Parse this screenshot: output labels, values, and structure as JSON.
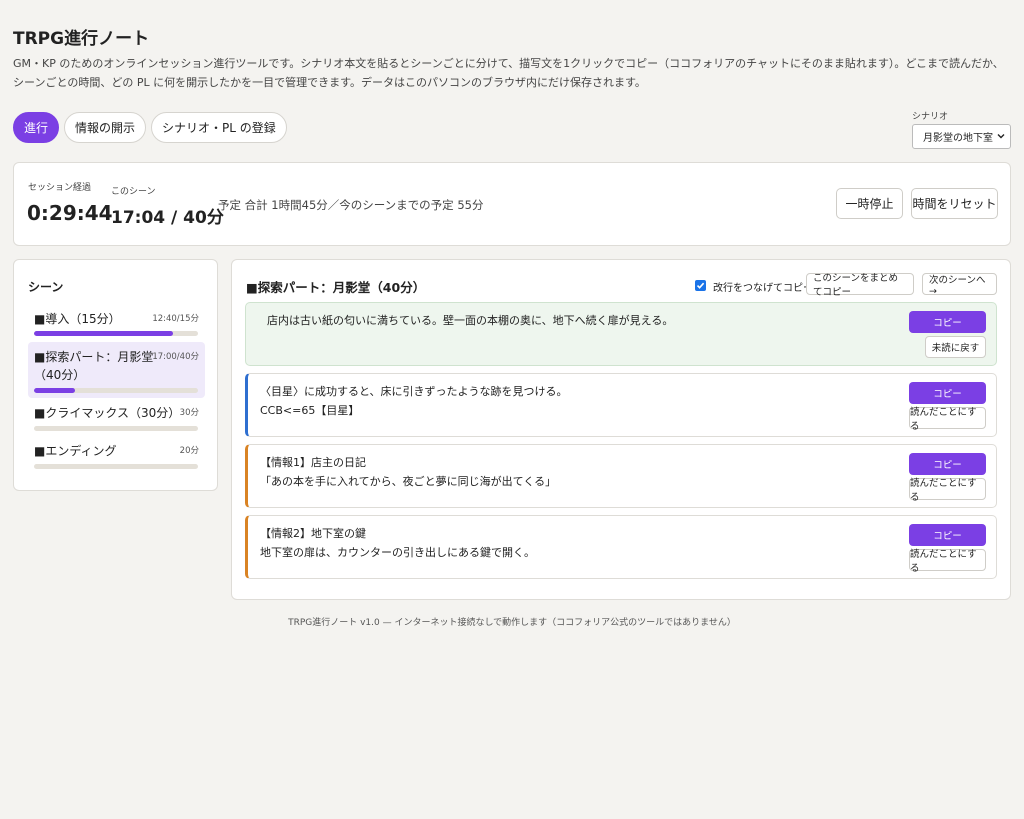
{
  "app": {
    "title": "TRPG進行ノート",
    "description": "GM・KP のためのオンラインセッション進行ツールです。シナリオ本文を貼るとシーンごとに分けて、描写文を1クリックでコピー（ココフォリアのチャットにそのまま貼れます）。どこまで読んだか、シーンごとの時間、どの PL に何を開示したかを一目で管理できます。データはこのパソコンのブラウザ内にだけ保存されます。"
  },
  "tabs": [
    {
      "label": "進行",
      "active": true
    },
    {
      "label": "情報の開示",
      "active": false
    },
    {
      "label": "シナリオ・PL の登録",
      "active": false
    }
  ],
  "scenario": {
    "label": "シナリオ",
    "selected": "月影堂の地下室"
  },
  "timer": {
    "elapsed_label": "セッション経過",
    "elapsed": "0:29:44",
    "scene_label": "このシーン",
    "scene_time": "17:04 / 40分",
    "plan": "予定 合計 1時間45分／今のシーンまでの予定 55分",
    "pause_label": "一時停止",
    "reset_label": "時間をリセット"
  },
  "scenes": {
    "heading": "シーン",
    "items": [
      {
        "name": "■導入（15分）",
        "time": "12:40/15分",
        "progress": 0.85
      },
      {
        "name": "■探索パート：月影堂（40分）",
        "time": "17:00/40分",
        "progress": 0.25
      },
      {
        "name": "■クライマックス（30分）",
        "time": "30分",
        "progress": 0
      },
      {
        "name": "■エンディング",
        "time": "20分",
        "progress": 0
      }
    ]
  },
  "main": {
    "title": "■探索パート：月影堂（40分）",
    "join_lines_label": "改行をつなげてコピー",
    "copy_scene_label": "このシーンをまとめてコピー",
    "next_scene_label": "次のシーンへ →",
    "blocks": [
      {
        "lines": [
          "店内は古い紙の匂いに満ちている。壁一面の本棚の奥に、地下へ続く扉が見える。"
        ],
        "copy_label": "コピー",
        "mark_label": "未読に戻す"
      },
      {
        "lines": [
          "〈目星〉に成功すると、床に引きずったような跡を見つける。",
          "CCB<=65【目星】"
        ],
        "copy_label": "コピー",
        "mark_label": "読んだことにする"
      },
      {
        "lines": [
          "【情報1】店主の日記",
          "「あの本を手に入れてから、夜ごと夢に同じ海が出てくる」"
        ],
        "copy_label": "コピー",
        "mark_label": "読んだことにする"
      },
      {
        "lines": [
          "【情報2】地下室の鍵",
          "地下室の扉は、カウンターの引き出しにある鍵で開く。"
        ],
        "copy_label": "コピー",
        "mark_label": "読んだことにする"
      }
    ]
  },
  "footer": "TRPG進行ノート v1.0 — インターネット接続なしで動作します（ココフォリア公式のツールではありません）",
  "colors": {
    "accent": "#7b3fe4",
    "read_bg": "#eef6ee",
    "check_border": "#2f6fd0",
    "info_border": "#d98324"
  }
}
